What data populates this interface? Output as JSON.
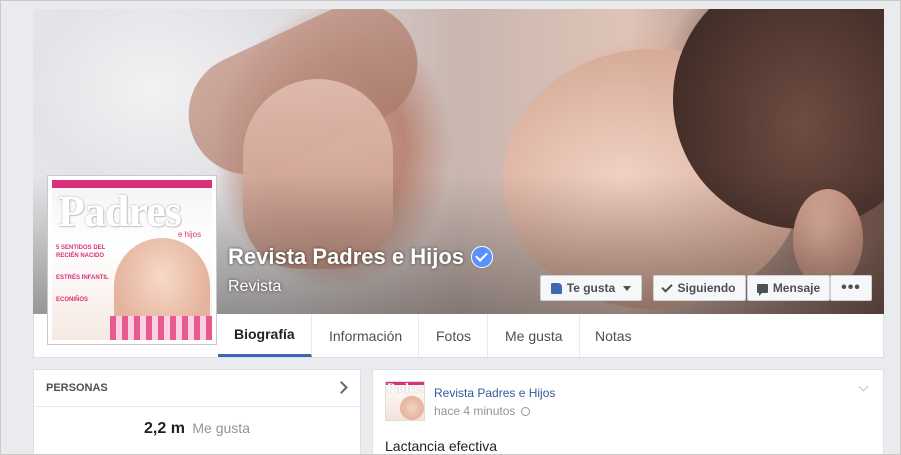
{
  "page": {
    "name": "Revista Padres e Hijos",
    "category": "Revista"
  },
  "actions": {
    "like_label": "Te gusta",
    "follow_label": "Siguiendo",
    "message_label": "Mensaje",
    "more_label": "•••"
  },
  "tabs": [
    {
      "label": "Biografía",
      "active": true
    },
    {
      "label": "Información"
    },
    {
      "label": "Fotos"
    },
    {
      "label": "Me gusta"
    },
    {
      "label": "Notas"
    }
  ],
  "profile_picture": {
    "title": "Padres",
    "subtitle": "e hijos",
    "headlines": [
      "5 SENTIDOS DEL RECIÉN NACIDO",
      "ESTRÉS INFANTIL",
      "ECONIÑOS"
    ]
  },
  "people_card": {
    "header": "PERSONAS",
    "likes_count": "2,2 m",
    "likes_label": "Me gusta"
  },
  "post": {
    "author": "Revista Padres e Hijos",
    "time": "hace 4 minutos",
    "text_preview": "Lactancia efectiva"
  },
  "colors": {
    "accent": "#4267b2",
    "verified": "#5890ff",
    "link": "#365899",
    "magazine_pink": "#d8307a"
  }
}
